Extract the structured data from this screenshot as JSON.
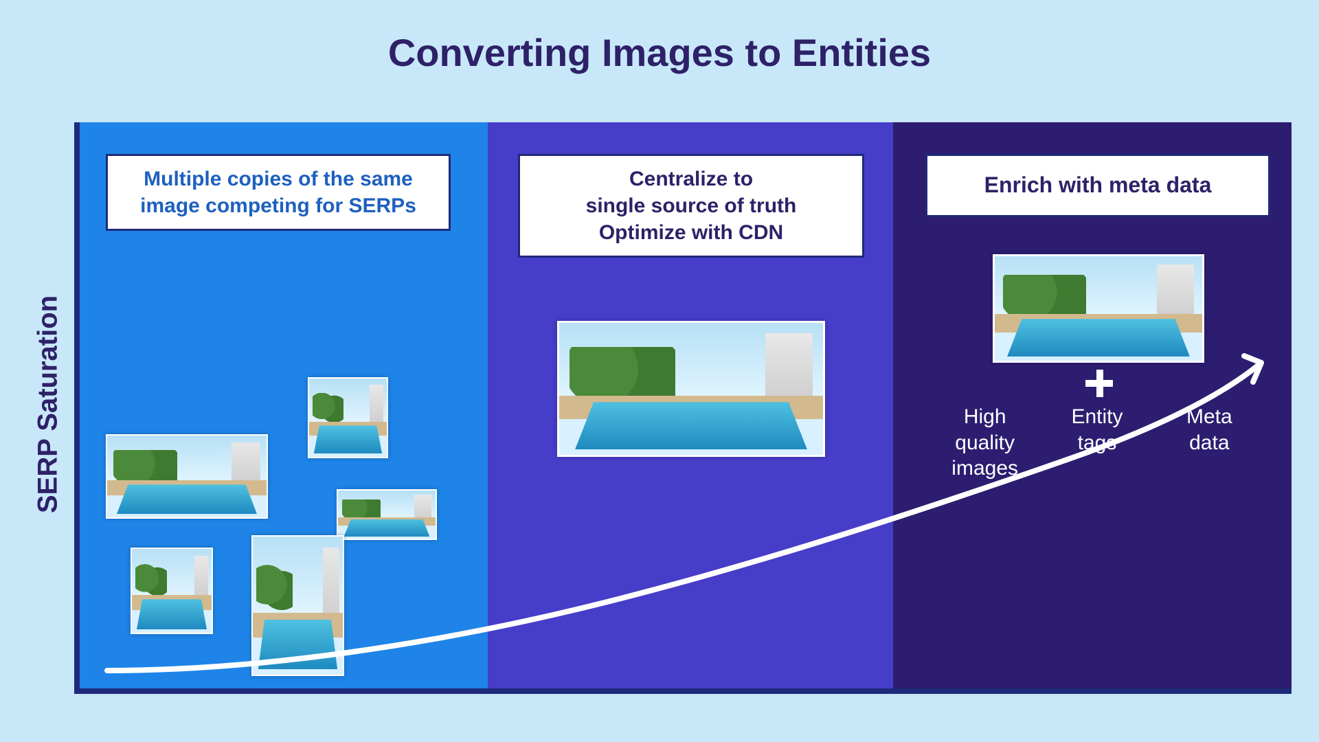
{
  "title": "Converting Images to Entities",
  "y_axis": "SERP Saturation",
  "panels": {
    "left": {
      "label": "Multiple copies of the same image competing for SERPs"
    },
    "middle": {
      "label": "Centralize to\nsingle source of truth\nOptimize with CDN"
    },
    "right": {
      "label": "Enrich with meta data"
    }
  },
  "meta": {
    "plus": "+",
    "items": [
      "High quality images",
      "Entity tags",
      "Meta data"
    ]
  },
  "colors": {
    "page_bg": "#c8e8fa",
    "title": "#2e2168",
    "axis": "#1f2a7a",
    "panel1": "#1e84e8",
    "panel2": "#463dc9",
    "panel3": "#2d1d70"
  }
}
